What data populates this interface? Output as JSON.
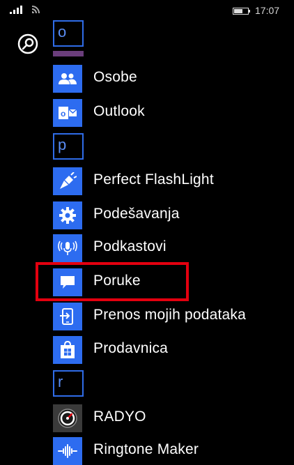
{
  "status_bar": {
    "time": "17:07"
  },
  "letters": {
    "o": "o",
    "p": "p",
    "r": "r"
  },
  "apps": [
    {
      "label": "Osobe",
      "icon": "people-icon"
    },
    {
      "label": "Outlook",
      "icon": "outlook-icon"
    },
    {
      "label": "Perfect FlashLight",
      "icon": "flashlight-icon"
    },
    {
      "label": "Podešavanja",
      "icon": "gear-icon"
    },
    {
      "label": "Podkastovi",
      "icon": "podcast-icon"
    },
    {
      "label": "Poruke",
      "icon": "message-icon"
    },
    {
      "label": "Prenos mojih podataka",
      "icon": "transfer-icon"
    },
    {
      "label": "Prodavnica",
      "icon": "store-icon"
    },
    {
      "label": "RADYO",
      "icon": "radio-icon"
    },
    {
      "label": "Ringtone Maker",
      "icon": "ringtone-icon"
    }
  ],
  "colors": {
    "accent": "#2d6cf0",
    "highlight": "#e3000f",
    "background": "#000000"
  }
}
